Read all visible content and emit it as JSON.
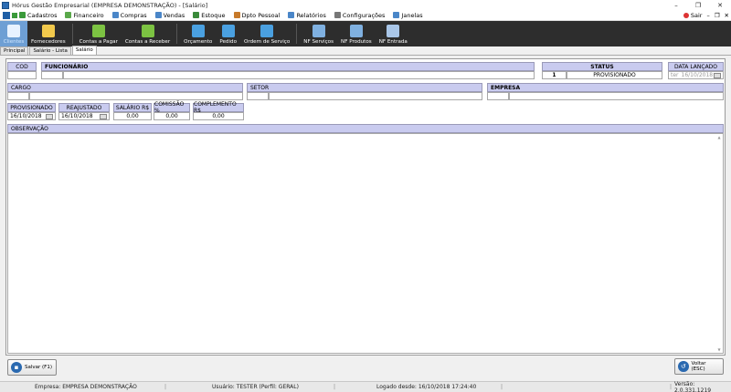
{
  "window": {
    "title": "Hórus Gestão Empresarial (EMPRESA DEMONSTRAÇÃO) - [Salário]",
    "minimize": "–",
    "maximize": "❐",
    "close": "✕"
  },
  "menu": {
    "items": [
      {
        "label": "Cadastros",
        "color": "#3a9a3a"
      },
      {
        "label": "Financeiro",
        "color": "#5aa84a"
      },
      {
        "label": "Compras",
        "color": "#4a86c8"
      },
      {
        "label": "Vendas",
        "color": "#4a86c8"
      },
      {
        "label": "Estoque",
        "color": "#3a8a3a"
      },
      {
        "label": "Dpto Pessoal",
        "color": "#c77a2a"
      },
      {
        "label": "Relatórios",
        "color": "#4a86c8"
      },
      {
        "label": "Configurações",
        "color": "#777777"
      },
      {
        "label": "Janelas",
        "color": "#4a86c8"
      }
    ],
    "sair": "Sair",
    "mdi_min": "–",
    "mdi_restore": "❐",
    "mdi_close": "✕"
  },
  "toolbar": {
    "buttons": [
      {
        "label": "Clientes",
        "color": "#e8f2ff",
        "active": true
      },
      {
        "label": "Fornecedores",
        "color": "#f2c94c"
      },
      {
        "label": "Contas a Pagar",
        "color": "#7cc242"
      },
      {
        "label": "Contas a Receber",
        "color": "#7cc242"
      },
      {
        "label": "Orçamento",
        "color": "#4aa0e0"
      },
      {
        "label": "Pedido",
        "color": "#4aa0e0"
      },
      {
        "label": "Ordem de Serviço",
        "color": "#4aa0e0"
      },
      {
        "label": "NF Serviços",
        "color": "#7fb0e0"
      },
      {
        "label": "NF Produtos",
        "color": "#7fb0e0"
      },
      {
        "label": "NF Entrada",
        "color": "#a9c6e8"
      }
    ]
  },
  "tabs": [
    "Principal",
    "Salário - Lista",
    "Salário"
  ],
  "form": {
    "cod_label": "COD",
    "cod_value": "",
    "funcionario_label": "FUNCIONÁRIO",
    "funcionario_id": "",
    "funcionario_nome": "",
    "status_label": "STATUS",
    "status_num": "1",
    "status_value": "PROVISIONADO",
    "data_lancado_label": "DATA LANÇADO",
    "data_lancado_prefix": "ter",
    "data_lancado_value": "16/10/2018",
    "cargo_label": "CARGO",
    "setor_label": "SETOR",
    "empresa_label": "EMPRESA",
    "provisionado_label": "PROVISIONADO",
    "provisionado_value": "16/10/2018",
    "reajustado_label": "REAJUSTADO",
    "reajustado_value": "16/10/2018",
    "salario_label": "SALÁRIO R$",
    "salario_value": "0,00",
    "comissao_label": "COMISSÃO %",
    "comissao_value": "0,00",
    "complemento_label": "COMPLEMENTO R$",
    "complemento_value": "0,00",
    "observacao_label": "OBSERVAÇÃO"
  },
  "buttons": {
    "salvar": "Salvar (F1)",
    "voltar": "Voltar (ESC)"
  },
  "status_bar": {
    "empresa": "Empresa: EMPRESA DEMONSTRAÇÃO",
    "usuario": "Usuário: TESTER (Perfil: GERAL)",
    "logado": "Logado desde: 16/10/2018 17:24:40",
    "versao": "Versão: 2.0.331.1219"
  }
}
